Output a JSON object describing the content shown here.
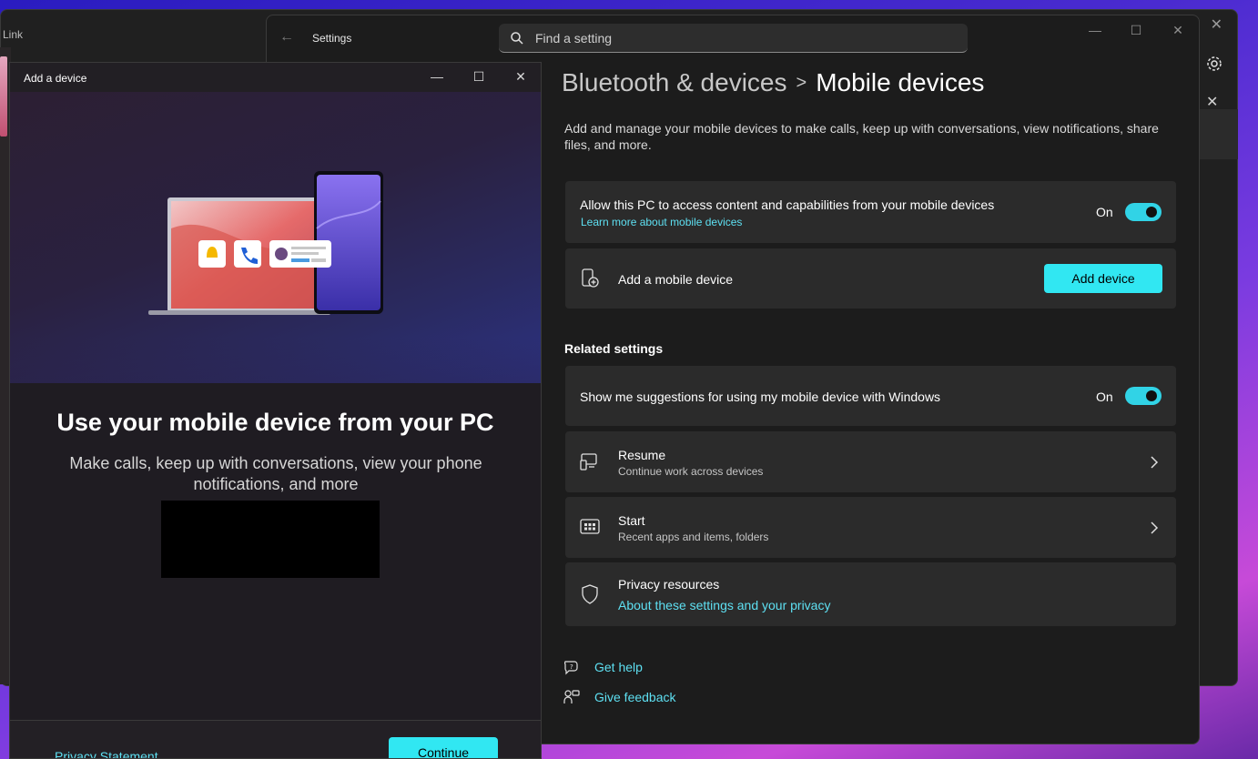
{
  "background_window": {
    "title": "Link"
  },
  "settings": {
    "app_title": "Settings",
    "search_placeholder": "Find a setting",
    "breadcrumb": {
      "parent": "Bluetooth & devices",
      "separator": ">",
      "current": "Mobile devices"
    },
    "description": "Add and manage your mobile devices to make calls, keep up with conversations, view notifications, share files, and more.",
    "access_card": {
      "title": "Allow this PC to access content and capabilities from your mobile devices",
      "link": "Learn more about mobile devices",
      "toggle_label": "On",
      "toggle_on": true
    },
    "add_card": {
      "title": "Add a mobile device",
      "button": "Add device",
      "icon": "add-phone-icon"
    },
    "related_heading": "Related settings",
    "suggestions_card": {
      "title": "Show me suggestions for using my mobile device with Windows",
      "toggle_label": "On",
      "toggle_on": true
    },
    "resume_card": {
      "title": "Resume",
      "subtitle": "Continue work across devices",
      "icon": "resume-devices-icon"
    },
    "start_card": {
      "title": "Start",
      "subtitle": "Recent apps and items, folders",
      "icon": "start-menu-icon"
    },
    "privacy_card": {
      "title": "Privacy resources",
      "link": "About these settings and your privacy",
      "icon": "shield-icon"
    },
    "help": {
      "get_help": "Get help",
      "give_feedback": "Give feedback"
    }
  },
  "dialog": {
    "title": "Add a device",
    "heading": "Use your mobile device from your PC",
    "subtext": "Make calls, keep up with conversations, view your phone notifications, and more",
    "privacy_link": "Privacy Statement",
    "continue_button": "Continue"
  },
  "colors": {
    "accent": "#31e7f2",
    "link": "#5ee0f2",
    "card": "#2b2b2b",
    "window": "#1c1c1c"
  }
}
